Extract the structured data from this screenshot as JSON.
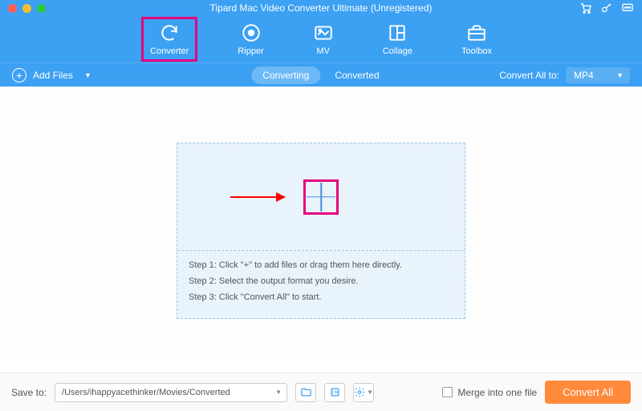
{
  "title": "Tipard Mac Video Converter Ultimate (Unregistered)",
  "nav": {
    "converter": "Converter",
    "ripper": "Ripper",
    "mv": "MV",
    "collage": "Collage",
    "toolbox": "Toolbox"
  },
  "subbar": {
    "add_files": "Add Files",
    "tab_converting": "Converting",
    "tab_converted": "Converted",
    "convert_all_to": "Convert All to:",
    "format": "MP4"
  },
  "dropzone": {
    "step1": "Step 1: Click \"+\" to add files or drag them here directly.",
    "step2": "Step 2: Select the output format you desire.",
    "step3": "Step 3: Click \"Convert All\" to start."
  },
  "footer": {
    "save_to": "Save to:",
    "path": "/Users/ihappyacethinker/Movies/Converted",
    "merge": "Merge into one file",
    "convert_all": "Convert All"
  }
}
